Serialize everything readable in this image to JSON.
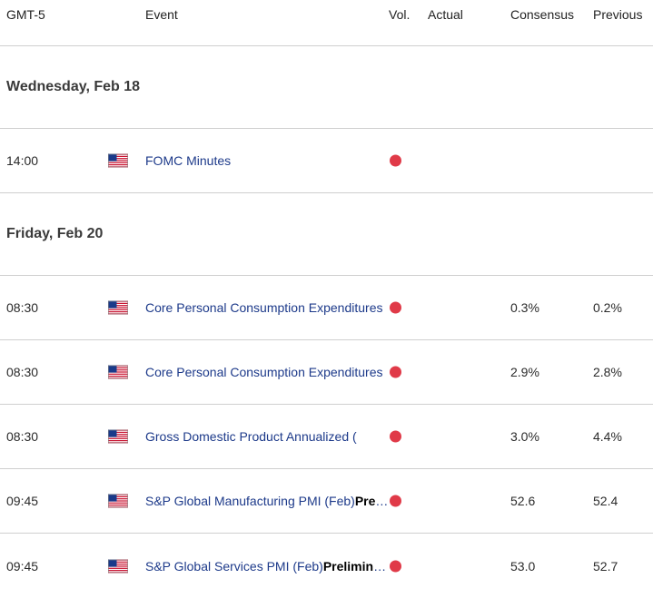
{
  "header": {
    "timezone": "GMT-5",
    "event": "Event",
    "vol": "Vol.",
    "actual": "Actual",
    "consensus": "Consensus",
    "previous": "Previous"
  },
  "dates": [
    "Wednesday, Feb 18",
    "Friday, Feb 20"
  ],
  "events": [
    {
      "time": "14:00",
      "name": "FOMC Minutes",
      "bold": "",
      "actual": "",
      "consensus": "",
      "previous": "",
      "flag": "us-flag-icon"
    },
    {
      "time": "08:30",
      "name": "Core Personal Consumption Expenditures",
      "bold": "",
      "actual": "",
      "consensus": "0.3%",
      "previous": "0.2%",
      "flag": "us-flag-icon"
    },
    {
      "time": "08:30",
      "name": "Core Personal Consumption Expenditures",
      "bold": "",
      "actual": "",
      "consensus": "2.9%",
      "previous": "2.8%",
      "flag": "us-flag-icon"
    },
    {
      "time": "08:30",
      "name": "Gross Domestic Product Annualized (",
      "bold": "",
      "actual": "",
      "consensus": "3.0%",
      "previous": "4.4%",
      "flag": "us-flag-icon"
    },
    {
      "time": "09:45",
      "name": "S&P Global Manufacturing PMI (Feb)",
      "bold": "Preliminary",
      "actual": "",
      "consensus": "52.6",
      "previous": "52.4",
      "flag": "us-flag-icon"
    },
    {
      "time": "09:45",
      "name": "S&P Global Services PMI (Feb)",
      "bold": "Preliminary",
      "actual": "",
      "consensus": "53.0",
      "previous": "52.7",
      "flag": "us-flag-icon"
    }
  ],
  "colors": {
    "volatility_high": "#e03a48",
    "event_link": "#1d3a8a"
  }
}
